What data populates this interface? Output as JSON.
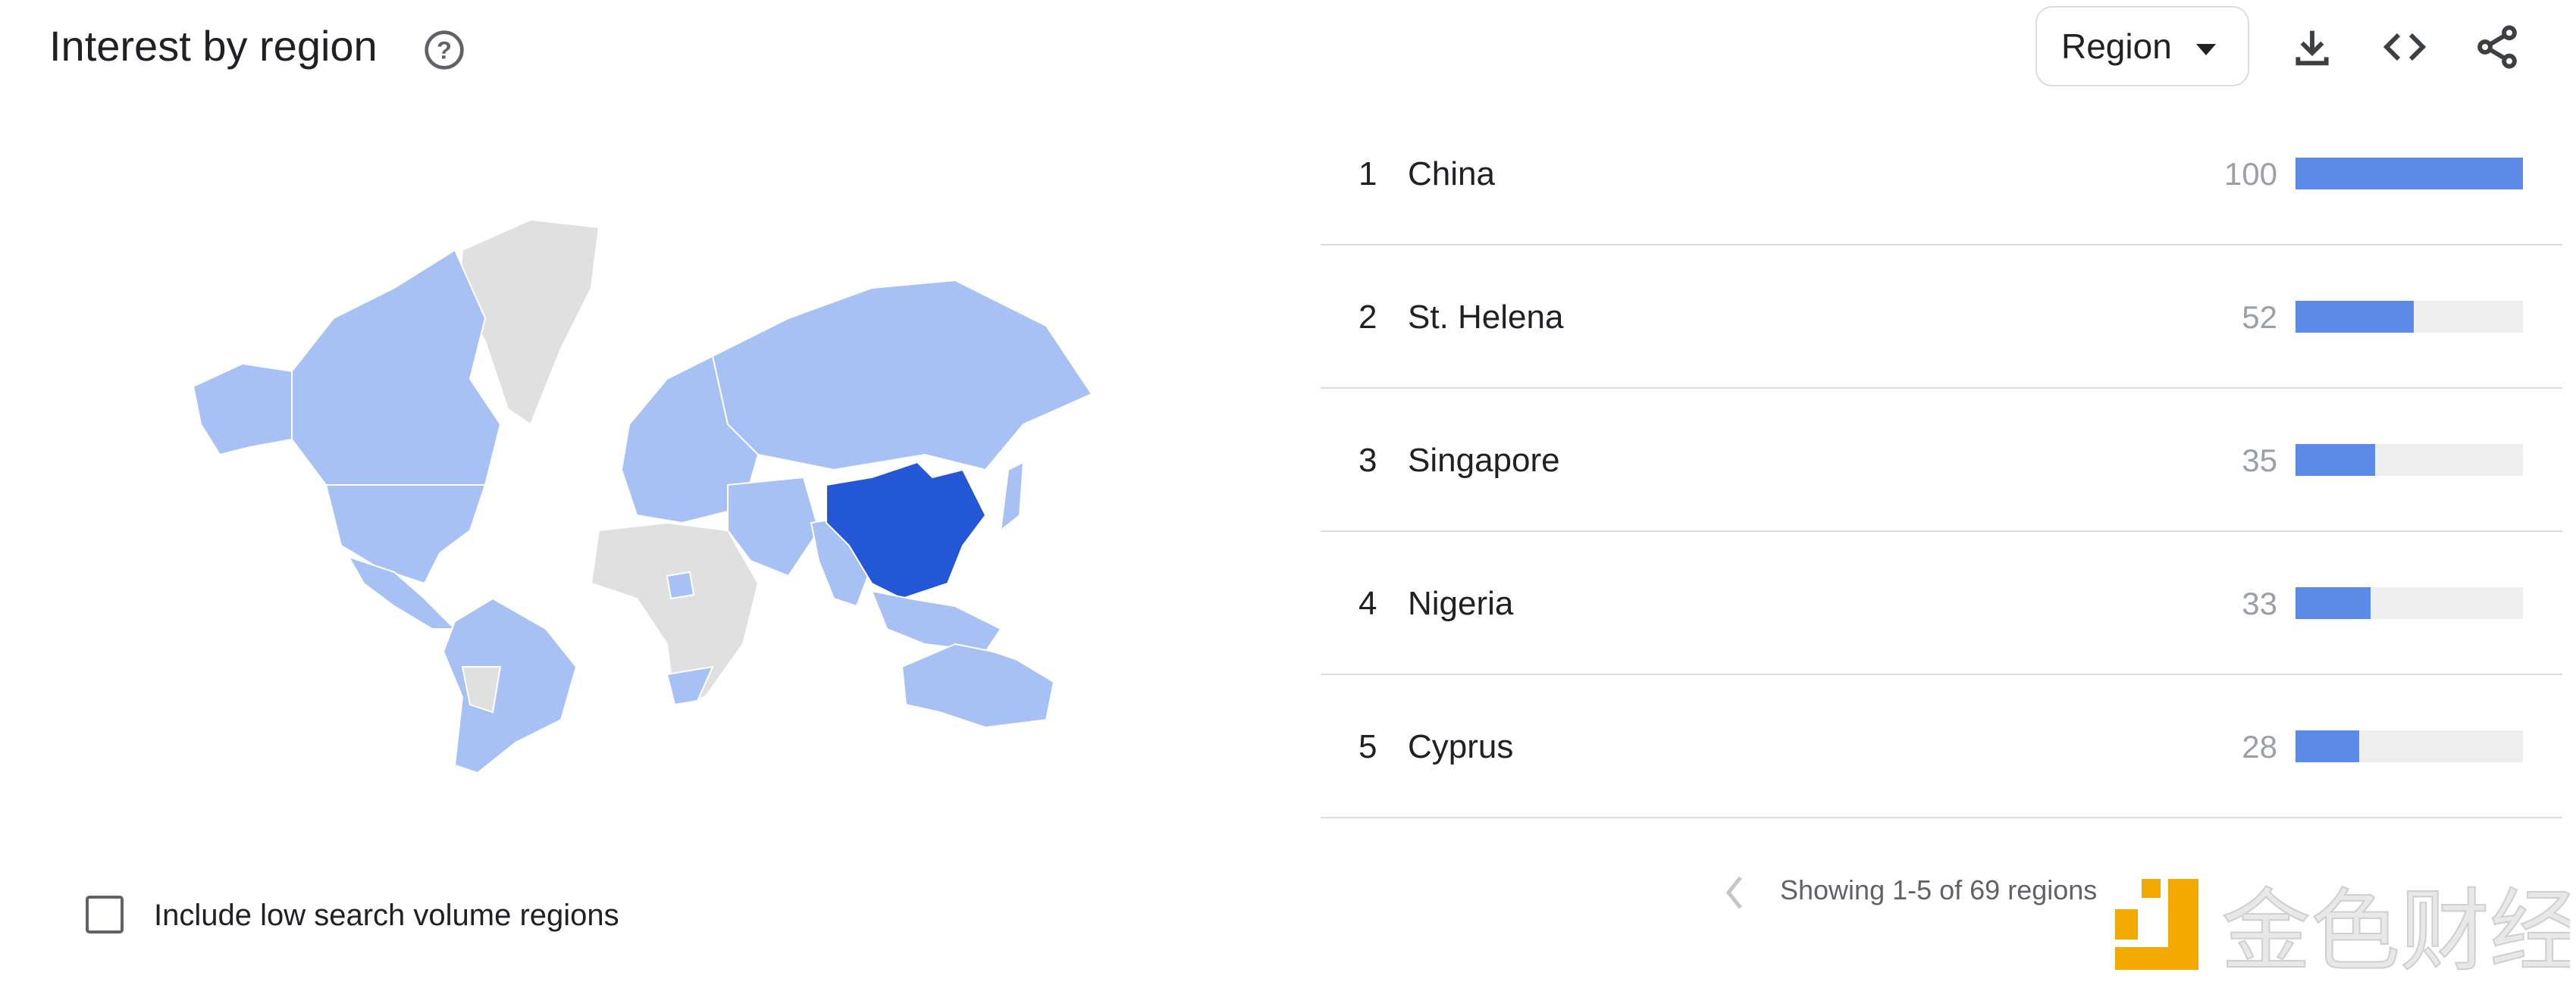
{
  "header": {
    "title": "Interest by region",
    "help_icon": "help-circle-icon",
    "region_select": {
      "selected": "Region",
      "icon": "caret-down-icon"
    },
    "actions": [
      {
        "name": "download",
        "icon": "download-icon"
      },
      {
        "name": "embed",
        "icon": "code-icon"
      },
      {
        "name": "share",
        "icon": "share-icon"
      }
    ]
  },
  "colors": {
    "highest": "#2457d6",
    "mid": "#a8c1f4",
    "no_data": "#e0e0e0",
    "bar_fill": "#5b8ae8",
    "bar_track": "#eeeeee"
  },
  "regions": [
    {
      "rank": "1",
      "name": "China",
      "value": "100"
    },
    {
      "rank": "2",
      "name": "St. Helena",
      "value": "52"
    },
    {
      "rank": "3",
      "name": "Singapore",
      "value": "35"
    },
    {
      "rank": "4",
      "name": "Nigeria",
      "value": "33"
    },
    {
      "rank": "5",
      "name": "Cyprus",
      "value": "28"
    }
  ],
  "footer": {
    "low_volume_label": "Include low search volume regions",
    "low_volume_checked": false,
    "pagination": "Showing 1-5 of 69 regions",
    "prev_icon": "chevron-left-icon"
  },
  "watermark": {
    "text": "金色财经"
  }
}
